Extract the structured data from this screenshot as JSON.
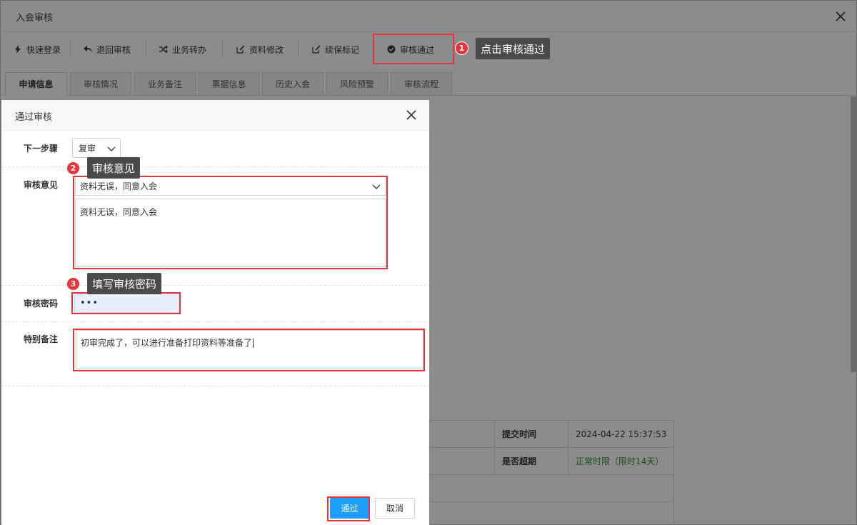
{
  "window": {
    "title": "入会审核"
  },
  "toolbar": {
    "items": [
      {
        "label": "快速登录"
      },
      {
        "label": "退回审核"
      },
      {
        "label": "业务转办"
      },
      {
        "label": "资料修改"
      },
      {
        "label": "续保标记"
      },
      {
        "label": "审核通过"
      }
    ]
  },
  "tabs": [
    {
      "label": "申请信息"
    },
    {
      "label": "审核情况"
    },
    {
      "label": "业务备注"
    },
    {
      "label": "票据信息"
    },
    {
      "label": "历史入会"
    },
    {
      "label": "风险预警"
    },
    {
      "label": "审核流程"
    }
  ],
  "background_table": {
    "submit_time_label": "提交时间",
    "submit_time_value": "2024-04-22 15:37:53",
    "overdue_label": "是否超期",
    "overdue_value": "正常时限（限时14天）"
  },
  "dialog": {
    "title": "通过审核",
    "next_step_label": "下一步骤",
    "next_step_value": "复审",
    "opinion_label": "审核意见",
    "opinion_select_value": "资料无误，同意入会",
    "opinion_text": "资料无误，同意入会",
    "password_label": "审核密码",
    "password_value": "•••",
    "note_label": "特别备注",
    "note_text": "初审完成了，可以进行准备打印资料等准备了",
    "ok_label": "通过",
    "cancel_label": "取消"
  },
  "annotations": [
    {
      "num": "1",
      "text": "点击审核通过"
    },
    {
      "num": "2",
      "text": "审核意见"
    },
    {
      "num": "3",
      "text": "填写审核密码"
    }
  ],
  "colors": {
    "accent": "#1e9fff",
    "highlight": "#e8323c",
    "status_ok": "#2e8b2e"
  }
}
